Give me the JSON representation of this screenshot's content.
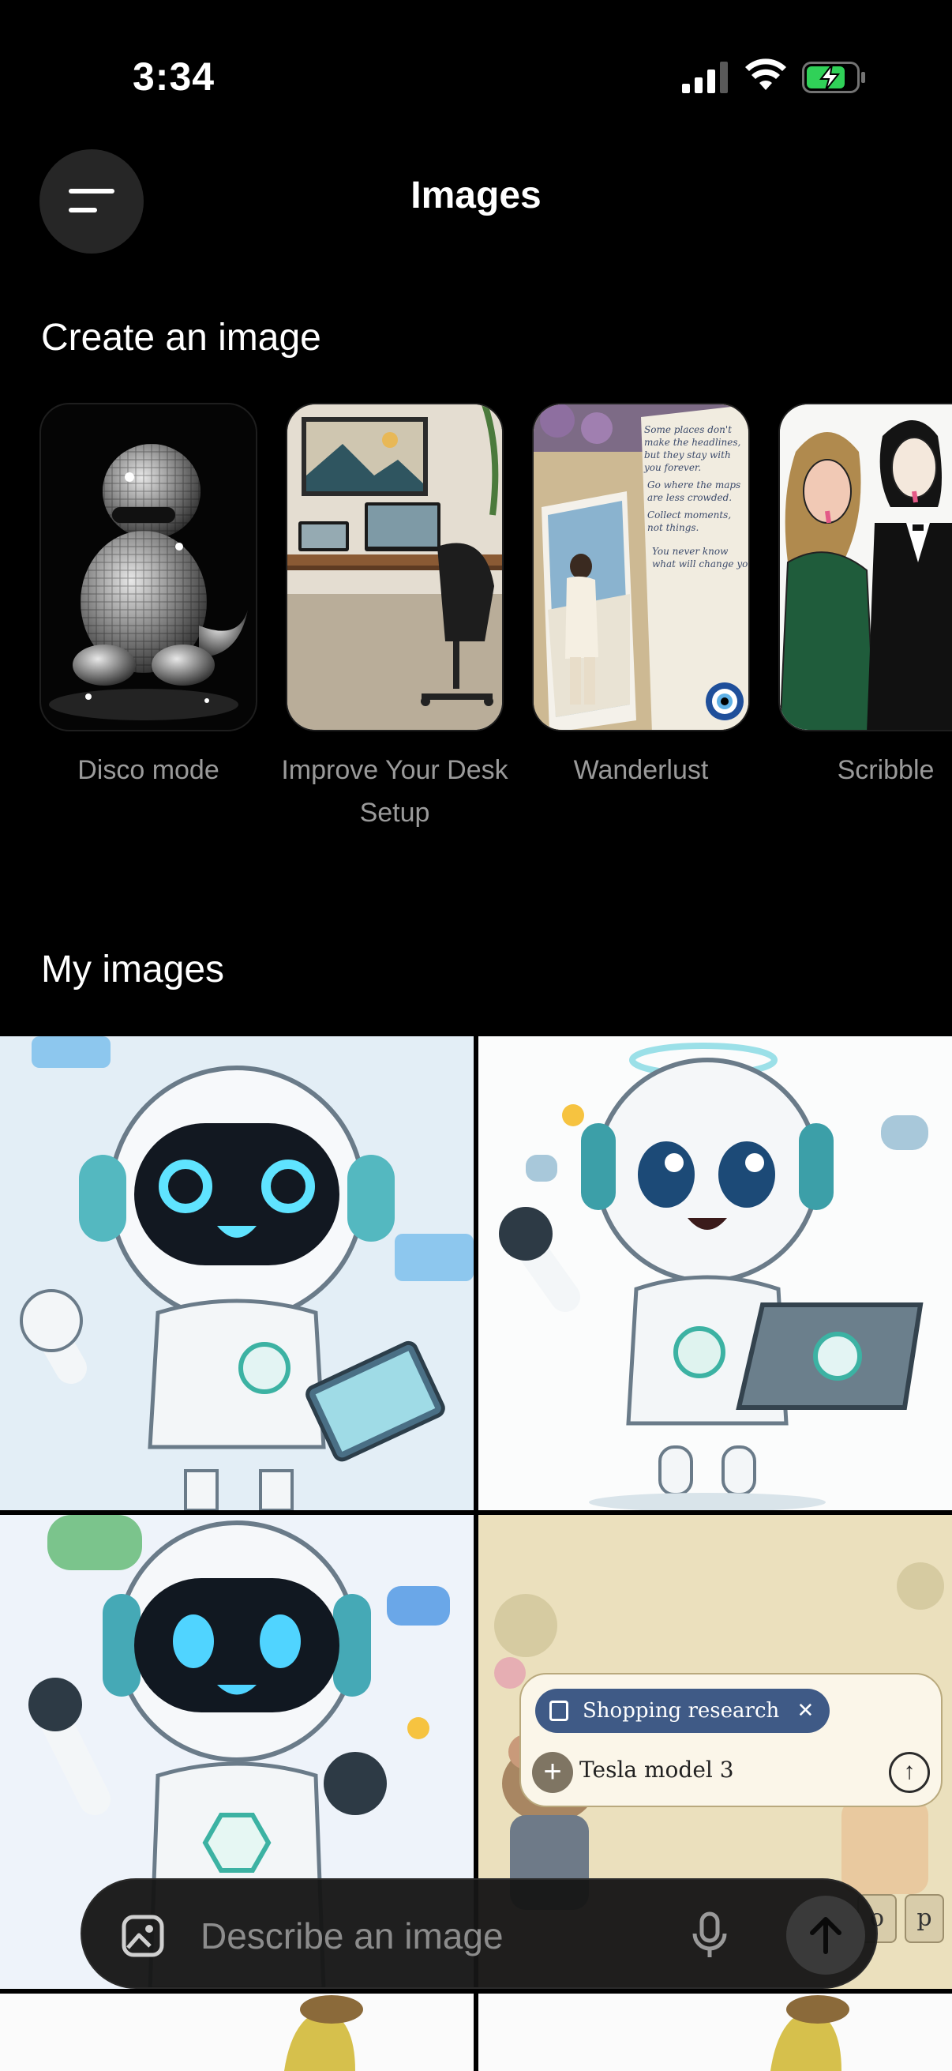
{
  "status_bar": {
    "time": "3:34"
  },
  "header": {
    "title": "Images"
  },
  "create_section": {
    "title": "Create an image",
    "styles": [
      {
        "label": "Disco mode"
      },
      {
        "label": "Improve Your Desk Setup"
      },
      {
        "label": "Wanderlust"
      },
      {
        "label": "Scribble"
      }
    ]
  },
  "my_images": {
    "title": "My images"
  },
  "embedded_ui": {
    "chip_label": "Shopping research",
    "input_text": "Tesla model 3",
    "keys": [
      "o",
      "p"
    ]
  },
  "note_text": [
    "Some places don't",
    "make the headlines,",
    "but they stay with",
    "you forever.",
    "Go where the maps",
    "are less crowded.",
    "Collect moments,",
    "not things.",
    "You never know",
    "what will change you."
  ],
  "composer": {
    "placeholder": "Describe an image"
  },
  "colors": {
    "background": "#000000",
    "surface": "#262626",
    "battery": "#30d158",
    "muted_text": "#9a9a9a"
  }
}
